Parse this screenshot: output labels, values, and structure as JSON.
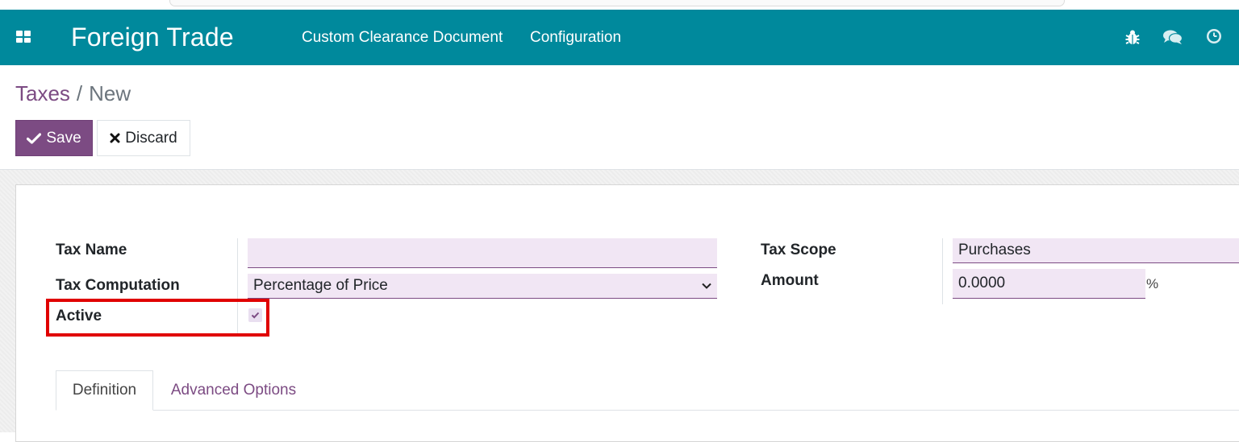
{
  "navbar": {
    "app_title": "Foreign Trade",
    "menu": [
      {
        "label": "Custom Clearance Document"
      },
      {
        "label": "Configuration"
      }
    ],
    "icons": [
      "apps-grid-icon",
      "bug-icon",
      "chat-icon",
      "clock-icon"
    ],
    "color": "#00899c"
  },
  "breadcrumb": {
    "parent": "Taxes",
    "separator": "/",
    "current": "New"
  },
  "toolbar": {
    "save_label": "Save",
    "discard_label": "Discard",
    "accent_color": "#7c4b83"
  },
  "form": {
    "tax_name_label": "Tax Name",
    "tax_name_value": "",
    "tax_computation_label": "Tax Computation",
    "tax_computation_value": "Percentage of Price",
    "active_label": "Active",
    "active_checked": true,
    "tax_scope_label": "Tax Scope",
    "tax_scope_value": "Purchases",
    "amount_label": "Amount",
    "amount_value": "0.0000",
    "amount_unit": "%"
  },
  "tabs": [
    {
      "label": "Definition",
      "active": true
    },
    {
      "label": "Advanced Options",
      "active": false
    }
  ],
  "highlight_color": "#e00000"
}
